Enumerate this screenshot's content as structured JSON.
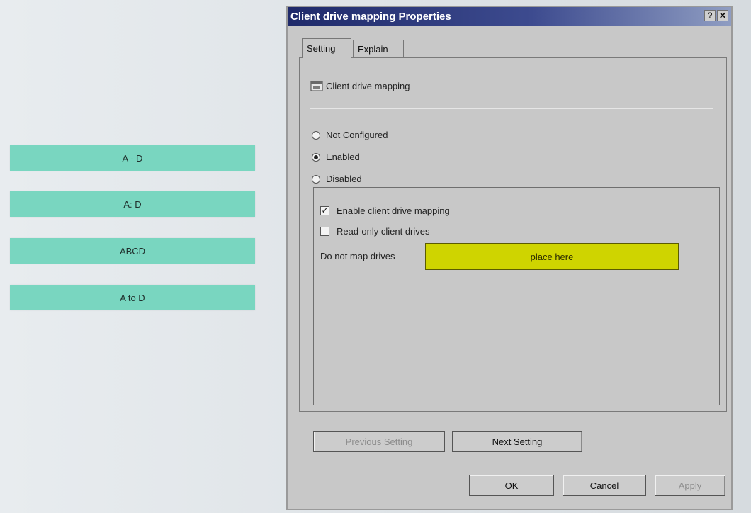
{
  "answers": [
    {
      "label": "A - D"
    },
    {
      "label": "A: D"
    },
    {
      "label": "ABCD"
    },
    {
      "label": "A to D"
    }
  ],
  "dialog": {
    "title": "Client drive mapping Properties",
    "help_glyph": "?",
    "close_glyph": "✕",
    "tabs": [
      {
        "label": "Setting",
        "selected": true
      },
      {
        "label": "Explain",
        "selected": false
      }
    ],
    "policy_name": "Client drive mapping",
    "policy_icon": "policy-icon",
    "state_options": [
      {
        "label": "Not Configured",
        "selected": false
      },
      {
        "label": "Enabled",
        "selected": true
      },
      {
        "label": "Disabled",
        "selected": false
      }
    ],
    "checkboxes": [
      {
        "label": "Enable client drive mapping",
        "checked": true,
        "mark": "✓"
      },
      {
        "label": "Read-only client drives",
        "checked": false,
        "mark": ""
      }
    ],
    "do_not_map_label": "Do not map drives",
    "drop_target_text": "place here",
    "buttons": {
      "previous": "Previous Setting",
      "next": "Next Setting",
      "ok": "OK",
      "cancel": "Cancel",
      "apply": "Apply"
    }
  },
  "colors": {
    "chip": "#79d6c0",
    "drop_target": "#cfd400",
    "titlebar": "#1f2a6a"
  }
}
